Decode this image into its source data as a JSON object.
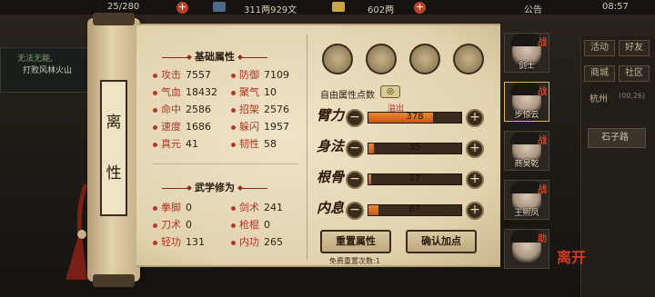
{
  "topbar": {
    "left_value": "25/280",
    "money": "311两929文",
    "silver": "602两",
    "notice": "公告",
    "clock": "08:57"
  },
  "quest": {
    "line1": "无法无能,",
    "line2": "打败风林火山"
  },
  "right_menu": {
    "items": [
      "活动",
      "好友",
      "商城",
      "社区"
    ],
    "location": "杭州",
    "coords": "(00,26)",
    "stone_road": "石子路"
  },
  "scroll_tag": [
    "离",
    "性"
  ],
  "basic_attrs": {
    "title": "基础属性",
    "rows": [
      {
        "label": "攻击",
        "value": "7557"
      },
      {
        "label": "防御",
        "value": "7109"
      },
      {
        "label": "气血",
        "value": "18432"
      },
      {
        "label": "聚气",
        "value": "10"
      },
      {
        "label": "命中",
        "value": "2586"
      },
      {
        "label": "招架",
        "value": "2576"
      },
      {
        "label": "速度",
        "value": "1686"
      },
      {
        "label": "躲闪",
        "value": "1957"
      },
      {
        "label": "真元",
        "value": "41"
      },
      {
        "label": "韧性",
        "value": "58"
      }
    ]
  },
  "martial": {
    "title": "武学修为",
    "rows": [
      {
        "label": "拳脚",
        "value": "0"
      },
      {
        "label": "剑术",
        "value": "241"
      },
      {
        "label": "刀术",
        "value": "0"
      },
      {
        "label": "枪棍",
        "value": "0"
      },
      {
        "label": "轻功",
        "value": "131"
      },
      {
        "label": "内功",
        "value": "265"
      }
    ]
  },
  "points": {
    "free_label": "自由属性点数",
    "free_value": "◎",
    "overflow_label": "溢出",
    "stats": [
      {
        "name": "臂力",
        "value": "378",
        "fill": 0.7
      },
      {
        "name": "身法",
        "value": "35",
        "fill": 0.06
      },
      {
        "name": "根骨",
        "value": "17",
        "fill": 0.03
      },
      {
        "name": "内息",
        "value": "67",
        "fill": 0.11
      }
    ],
    "minus": "−",
    "plus": "+"
  },
  "buttons": {
    "reset": "重置属性",
    "confirm": "确认加点",
    "reset_note": "免费重置次数:1"
  },
  "characters": [
    {
      "name": "剑士",
      "tag": "战"
    },
    {
      "name": "步惊云",
      "tag": "战"
    },
    {
      "name": "商昊乾",
      "tag": "战"
    },
    {
      "name": "王熙凤",
      "tag": "战"
    },
    {
      "name": "",
      "tag": "助"
    }
  ],
  "corner_rune": "离开",
  "colors": {
    "accent_red": "#b03424",
    "bar_orange": "#e88a2e",
    "paper": "#e9dcbc"
  }
}
